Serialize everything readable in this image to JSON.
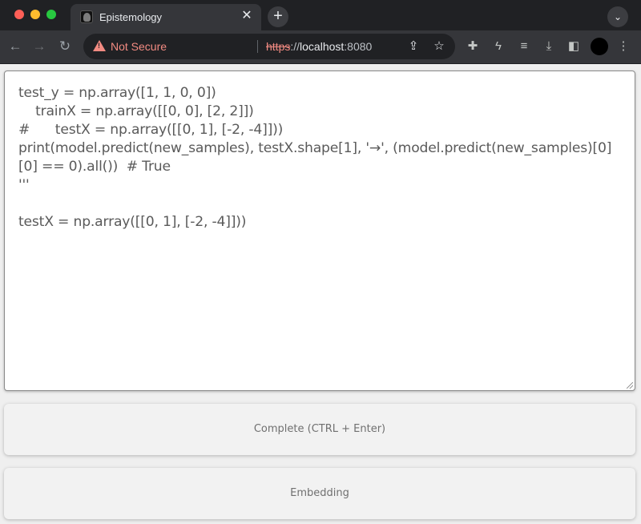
{
  "browser": {
    "tab_title": "Epistemology",
    "tab_close": "✕",
    "new_tab": "+",
    "tab_menu": "⌄",
    "security_label": "Not Secure",
    "url_scheme": "https",
    "url_sep": "://",
    "url_host": "localhost",
    "url_port": ":8080"
  },
  "icons": {
    "back": "←",
    "forward": "→",
    "reload": "↻",
    "share": "⇪",
    "star": "☆",
    "extensions": "✚",
    "bolt": "ϟ",
    "media": "≡",
    "download": "⤓",
    "sidepanel": "◧",
    "menu": "⋮"
  },
  "editor": {
    "content": "test_y = np.array([1, 1, 0, 0])\n    trainX = np.array([[0, 0], [2, 2]])\n#      testX = np.array([[0, 1], [-2, -4]]))\nprint(model.predict(new_samples), testX.shape[1], '→', (model.predict(new_samples)[0][0] == 0).all())  # True\n'''\n\ntestX = np.array([[0, 1], [-2, -4]]))"
  },
  "buttons": {
    "complete": "Complete (CTRL + Enter)",
    "embedding": "Embedding"
  }
}
